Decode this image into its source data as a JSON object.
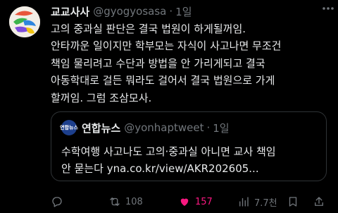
{
  "tweet": {
    "display_name": "교교사사",
    "handle": "@gyogyosasa",
    "separator": "·",
    "time": "1일",
    "more_icon": "more-dots-icon",
    "lines": [
      "고의 중과실 판단은 결국 법원이 하게될꺼임.",
      "안타까운 일이지만 학부모는 자식이 사고나면 무조건",
      "책임 물리려고 수단과 방법을 안 가리게되고 결국",
      "아동학대로 걸든 뭐라도 걸어서 결국 법원으로 가게",
      "할꺼임. 그럼 조삼모사."
    ]
  },
  "quote": {
    "logo_text": "연합뉴스",
    "display_name": "연합뉴스",
    "handle": "@yonhaptweet",
    "separator": "·",
    "time": "1일",
    "lines": [
      "수학여행 사고나도 고의·중과실 아니면 교사 책임",
      "안 묻는다 yna.co.kr/view/AKR202605..."
    ]
  },
  "actions": {
    "retweet_count": "108",
    "like_count": "157",
    "views_count": "7.7천",
    "like_color": "#f91880"
  }
}
